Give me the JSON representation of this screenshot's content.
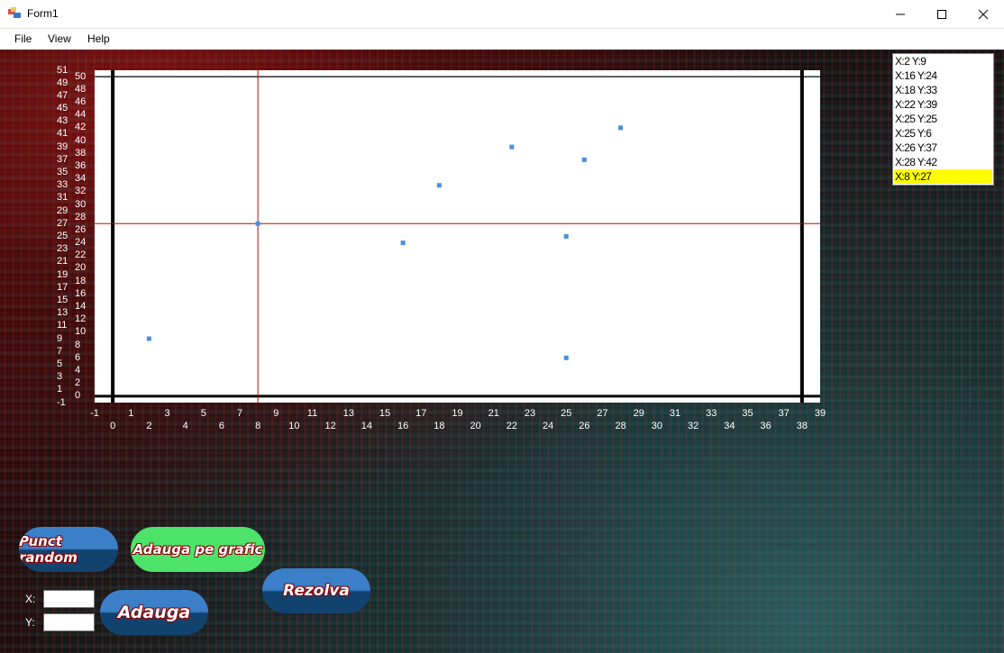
{
  "window": {
    "title": "Form1",
    "controls": {
      "minimize": "minimize",
      "maximize": "maximize",
      "close": "close"
    }
  },
  "menu": {
    "items": [
      "File",
      "View",
      "Help"
    ]
  },
  "chart_data": {
    "type": "scatter",
    "x_ticks_row1": [
      -1,
      1,
      3,
      5,
      7,
      9,
      11,
      13,
      15,
      17,
      19,
      21,
      23,
      25,
      27,
      29,
      31,
      33,
      35,
      37,
      39
    ],
    "x_ticks_row2": [
      0,
      2,
      4,
      6,
      8,
      10,
      12,
      14,
      16,
      18,
      20,
      22,
      24,
      26,
      28,
      30,
      32,
      34,
      36,
      38
    ],
    "y_ticks_outer": [
      51,
      49,
      47,
      45,
      43,
      41,
      39,
      37,
      35,
      33,
      31,
      29,
      27,
      25,
      23,
      21,
      19,
      17,
      15,
      13,
      11,
      9,
      7,
      5,
      3,
      1,
      -1
    ],
    "y_ticks_inner": [
      50,
      48,
      46,
      44,
      42,
      40,
      38,
      36,
      34,
      32,
      30,
      28,
      26,
      24,
      22,
      20,
      18,
      16,
      14,
      12,
      10,
      8,
      6,
      4,
      2,
      0
    ],
    "xlim": [
      -1,
      39
    ],
    "ylim": [
      -1,
      51
    ],
    "points": [
      {
        "x": 2,
        "y": 9
      },
      {
        "x": 16,
        "y": 24
      },
      {
        "x": 18,
        "y": 33
      },
      {
        "x": 22,
        "y": 39
      },
      {
        "x": 25,
        "y": 25
      },
      {
        "x": 25,
        "y": 6
      },
      {
        "x": 26,
        "y": 37
      },
      {
        "x": 28,
        "y": 42
      },
      {
        "x": 8,
        "y": 27
      }
    ],
    "boundary_lines": {
      "x": [
        0,
        38
      ],
      "y": [
        0,
        50
      ]
    },
    "crosshair": {
      "x": 8,
      "y": 27
    },
    "point_color": "#4a8fe0",
    "crosshair_color": "#cc0000",
    "boundary_color": "#000000"
  },
  "points_list": {
    "items": [
      "X:2 Y:9",
      "X:16 Y:24",
      "X:18 Y:33",
      "X:22 Y:39",
      "X:25 Y:25",
      "X:25 Y:6",
      "X:26 Y:37",
      "X:28 Y:42",
      "X:8 Y:27"
    ],
    "selected_index": 8,
    "highlight_color": "#ffff00"
  },
  "buttons": {
    "random_point": "Punct random",
    "add_to_chart": "Adauga pe grafic",
    "solve": "Rezolva",
    "add": "Adauga"
  },
  "inputs": {
    "x_label": "X:",
    "y_label": "Y:",
    "x_value": "",
    "y_value": ""
  }
}
